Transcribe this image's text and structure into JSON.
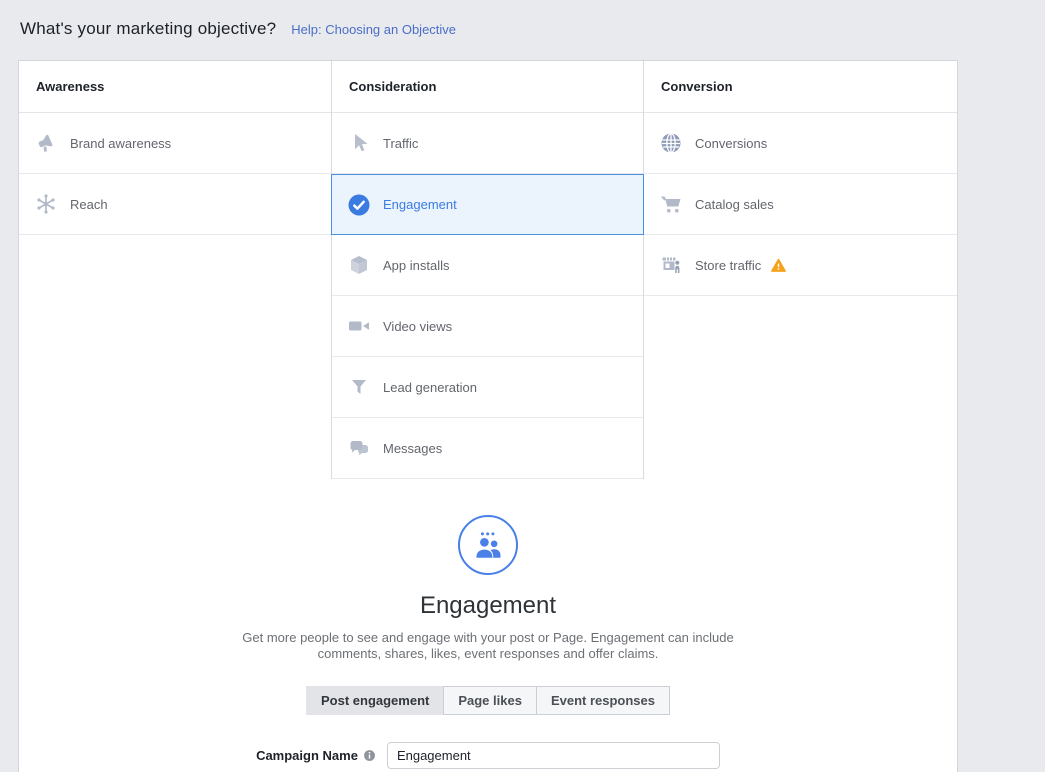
{
  "page": {
    "title": "What's your marketing objective?",
    "help_link": "Help: Choosing an Objective"
  },
  "objectives": {
    "columns": [
      {
        "header": "Awareness",
        "items": [
          {
            "label": "Brand awareness",
            "icon": "megaphone-icon"
          },
          {
            "label": "Reach",
            "icon": "reach-icon"
          }
        ]
      },
      {
        "header": "Consideration",
        "items": [
          {
            "label": "Traffic",
            "icon": "cursor-icon"
          },
          {
            "label": "Engagement",
            "icon": "check-circle-icon",
            "selected": true
          },
          {
            "label": "App installs",
            "icon": "cube-icon"
          },
          {
            "label": "Video views",
            "icon": "video-camera-icon"
          },
          {
            "label": "Lead generation",
            "icon": "funnel-icon"
          },
          {
            "label": "Messages",
            "icon": "chat-bubbles-icon"
          }
        ]
      },
      {
        "header": "Conversion",
        "items": [
          {
            "label": "Conversions",
            "icon": "globe-icon"
          },
          {
            "label": "Catalog sales",
            "icon": "cart-icon"
          },
          {
            "label": "Store traffic",
            "icon": "storefront-icon",
            "warning": true
          }
        ]
      }
    ]
  },
  "detail": {
    "icon": "engagement-people-icon",
    "title": "Engagement",
    "description": "Get more people to see and engage with your post or Page. Engagement can include comments, shares, likes, event responses and offer claims.",
    "tabs": [
      {
        "label": "Post engagement",
        "active": true
      },
      {
        "label": "Page likes",
        "active": false
      },
      {
        "label": "Event responses",
        "active": false
      }
    ],
    "campaign_name": {
      "label": "Campaign Name",
      "value": "Engagement"
    }
  },
  "colors": {
    "accent_blue": "#3b7ae0",
    "selected_row_bg": "#ebf3fc",
    "selected_row_border": "#4a90e2",
    "link_blue": "#4a6ec8",
    "warning_amber": "#f5a31d",
    "icon_gray_blue": "#b2bac9",
    "page_bg": "#e9eaed"
  }
}
